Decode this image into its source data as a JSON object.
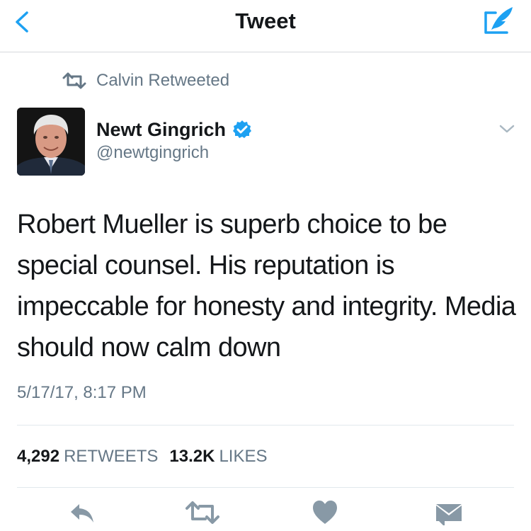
{
  "navbar": {
    "title": "Tweet",
    "back_icon": "chevron-left-icon",
    "compose_icon": "compose-quill-icon",
    "accent_color": "#1da1f2"
  },
  "retweet_context": {
    "icon": "retweet-icon",
    "label": "Calvin Retweeted"
  },
  "tweet": {
    "author": {
      "name": "Newt Gingrich",
      "handle": "@newtgingrich",
      "verified_icon": "verified-badge-icon"
    },
    "menu_icon": "chevron-down-icon",
    "text": "Robert Mueller is superb choice to be special counsel. His reputation is impeccable for honesty and integrity. Media should now calm down",
    "timestamp": "5/17/17, 8:17 PM"
  },
  "stats": {
    "retweets_count": "4,292",
    "retweets_label": "RETWEETS",
    "likes_count": "13.2K",
    "likes_label": "LIKES"
  },
  "actions": [
    {
      "name": "reply-icon"
    },
    {
      "name": "retweet-icon"
    },
    {
      "name": "like-heart-icon"
    },
    {
      "name": "direct-message-icon"
    }
  ],
  "colors": {
    "text_primary": "#14171a",
    "text_secondary": "#657786",
    "icon_gray": "#8899a6",
    "verified_blue": "#1da1f2",
    "divider": "#e1e8ed"
  }
}
